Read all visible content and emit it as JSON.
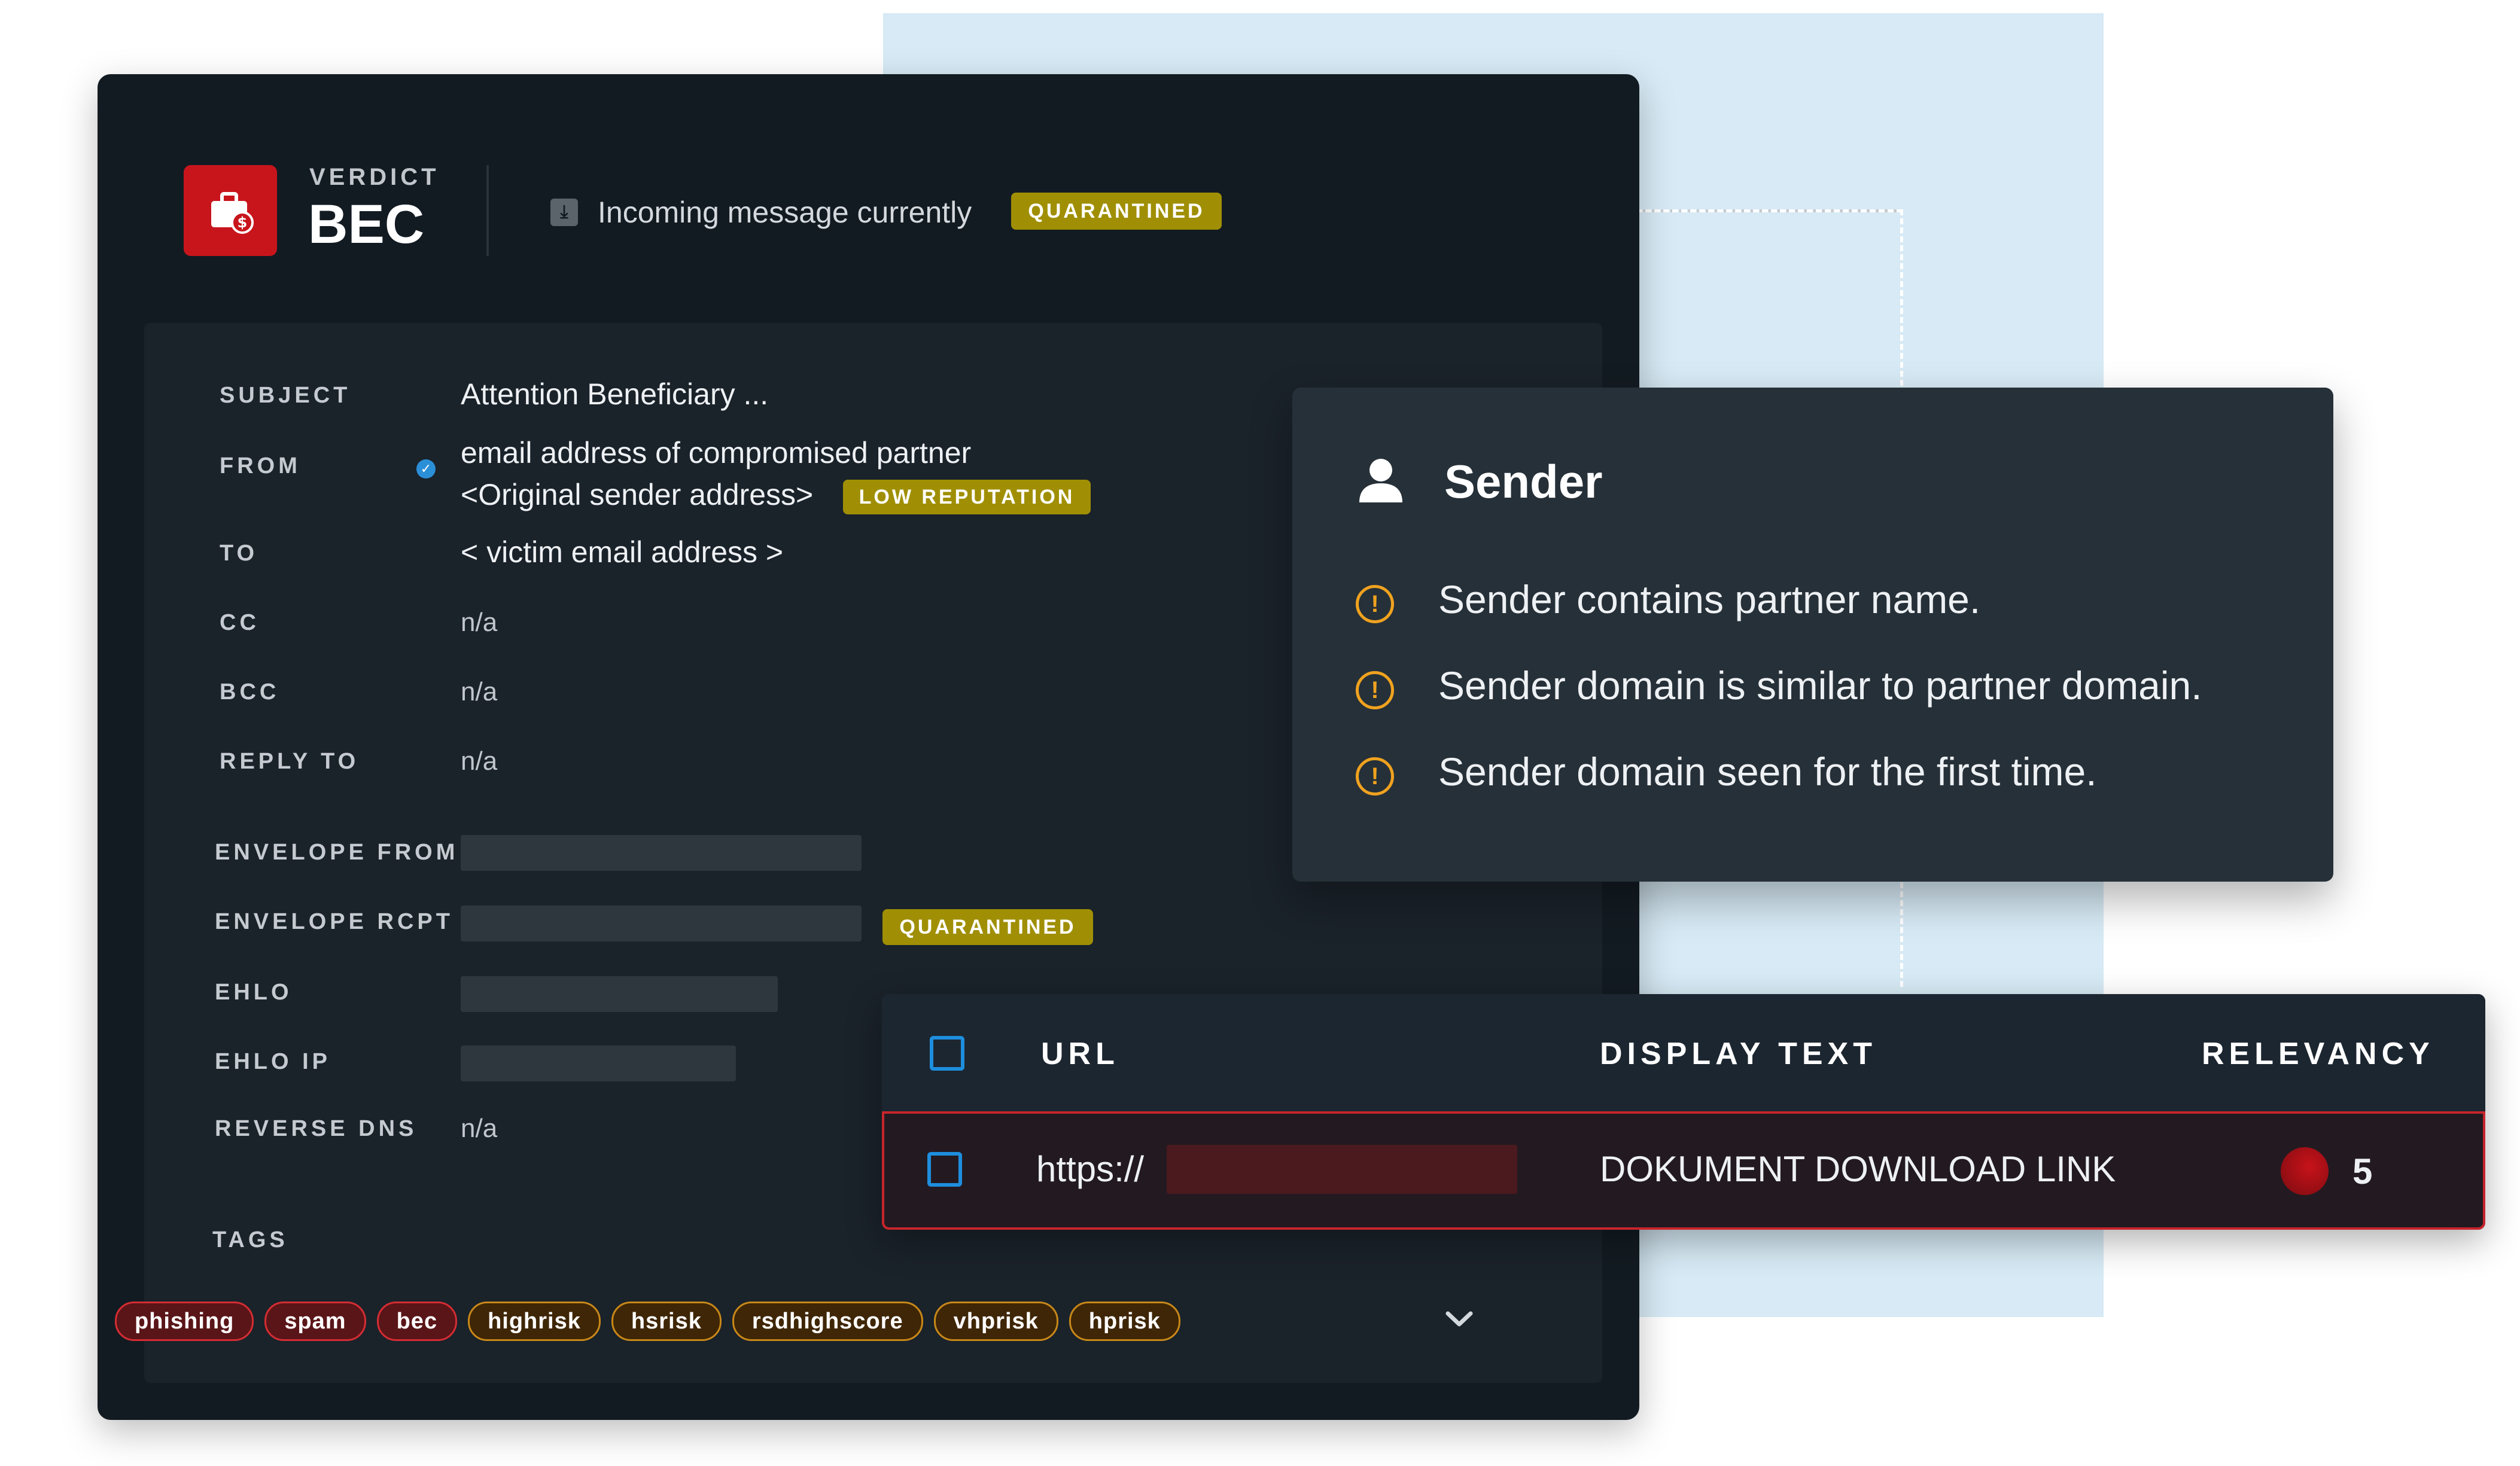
{
  "verdict": {
    "label": "VERDICT",
    "value": "BEC",
    "icon": "briefcase-dollar-icon"
  },
  "message": {
    "status_text": "Incoming message currently",
    "status_badge": "QUARANTINED",
    "icon": "download-tray-icon"
  },
  "fields": {
    "subject": {
      "label": "SUBJECT",
      "value": "Attention Beneficiary ..."
    },
    "from": {
      "label": "FROM",
      "line1": "email address of compromised partner",
      "line2": "<Original sender address>",
      "badge": "LOW REPUTATION",
      "icon": "verified-check-icon"
    },
    "to": {
      "label": "TO",
      "value": "< victim email address >"
    },
    "cc": {
      "label": "CC",
      "value": "n/a"
    },
    "bcc": {
      "label": "BCC",
      "value": "n/a"
    },
    "reply_to": {
      "label": "REPLY TO",
      "value": "n/a"
    },
    "envelope_from": {
      "label": "ENVELOPE FROM"
    },
    "envelope_rcpt": {
      "label": "ENVELOPE RCPT",
      "badge": "QUARANTINED"
    },
    "ehlo": {
      "label": "EHLO"
    },
    "ehlo_ip": {
      "label": "EHLO IP"
    },
    "reverse_dns": {
      "label": "REVERSE DNS",
      "value": "n/a"
    }
  },
  "tags": {
    "label": "TAGS",
    "items": [
      {
        "text": "phishing",
        "severity": "red"
      },
      {
        "text": "spam",
        "severity": "red"
      },
      {
        "text": "bec",
        "severity": "red"
      },
      {
        "text": "highrisk",
        "severity": "amber"
      },
      {
        "text": "hsrisk",
        "severity": "amber"
      },
      {
        "text": "rsdhighscore",
        "severity": "amber"
      },
      {
        "text": "vhprisk",
        "severity": "amber"
      },
      {
        "text": "hprisk",
        "severity": "amber"
      }
    ]
  },
  "sender": {
    "title": "Sender",
    "icon": "person-icon",
    "alerts": [
      "Sender contains partner name.",
      "Sender domain is similar to partner domain.",
      "Sender domain seen for the first time."
    ]
  },
  "urls": {
    "headers": {
      "url": "URL",
      "display_text": "DISPLAY TEXT",
      "relevancy": "RELEVANCY"
    },
    "rows": [
      {
        "url": "https://",
        "display_text": "DOKUMENT DOWNLOAD LINK",
        "relevancy": "5"
      }
    ]
  },
  "colors": {
    "danger": "#c8151c",
    "warning": "#f0a21f",
    "badge": "#a08f05",
    "accent": "#1e8ede"
  }
}
